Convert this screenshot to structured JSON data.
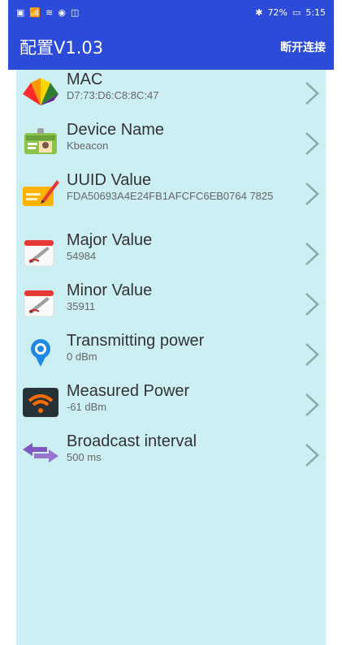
{
  "status": {
    "left_icons": "status-left",
    "battery": "72%",
    "time": "5:15"
  },
  "app": {
    "title": "配置V1.03",
    "action": "断开连接"
  },
  "items": [
    {
      "label": "MAC",
      "value": "D7:73:D6:C8:8C:47"
    },
    {
      "label": "Device Name",
      "value": "Kbeacon"
    },
    {
      "label": "UUID Value",
      "value": "FDA50693A4E24FB1AFCFC6EB0764 7825"
    },
    {
      "label": "Major Value",
      "value": "54984"
    },
    {
      "label": "Minor Value",
      "value": "35911"
    },
    {
      "label": "Transmitting power",
      "value": "0 dBm"
    },
    {
      "label": "Measured Power",
      "value": "-61 dBm"
    },
    {
      "label": "Broadcast interval",
      "value": "500 ms"
    }
  ],
  "colors": {
    "header": "#2b4bd8",
    "list_bg": "#cceff3"
  }
}
